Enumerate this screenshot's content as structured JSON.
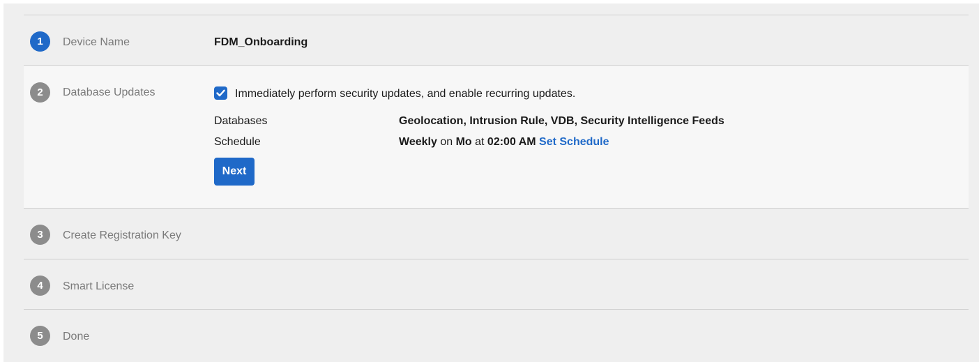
{
  "steps": [
    {
      "number": "1",
      "title": "Device Name",
      "value": "FDM_Onboarding"
    },
    {
      "number": "2",
      "title": "Database Updates"
    },
    {
      "number": "3",
      "title": "Create Registration Key"
    },
    {
      "number": "4",
      "title": "Smart License"
    },
    {
      "number": "5",
      "title": "Done"
    }
  ],
  "database_updates": {
    "checkbox_checked": true,
    "checkbox_label": "Immediately perform security updates, and enable recurring updates.",
    "databases_label": "Databases",
    "databases_value": "Geolocation, Intrusion Rule, VDB, Security Intelligence Feeds",
    "schedule_label": "Schedule",
    "schedule_frequency": "Weekly",
    "schedule_on_word": "on",
    "schedule_day": "Mo",
    "schedule_at_word": "at",
    "schedule_time": "02:00 AM",
    "set_schedule_link": "Set Schedule",
    "next_button": "Next"
  },
  "colors": {
    "accent": "#1f69c8",
    "panel_bg": "#efefef",
    "expanded_bg": "#f7f7f7",
    "inactive_step": "#8c8c8c"
  }
}
